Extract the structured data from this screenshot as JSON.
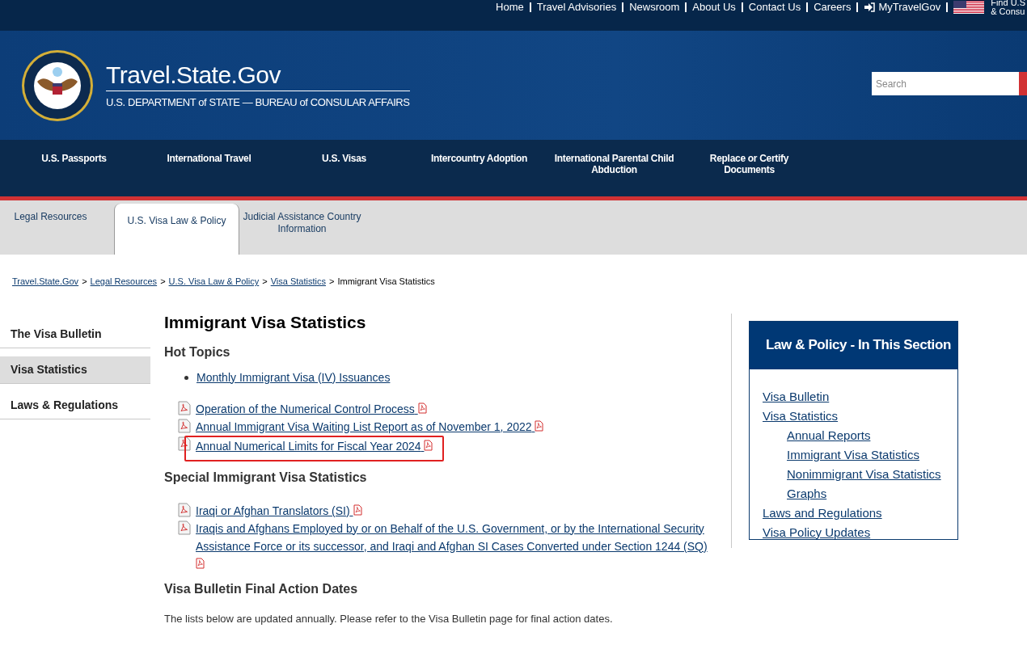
{
  "utility_links": [
    {
      "label": "Home",
      "kind": "text"
    },
    {
      "label": "Travel Advisories",
      "kind": "text"
    },
    {
      "label": "Newsroom",
      "kind": "text"
    },
    {
      "label": "About Us",
      "kind": "text"
    },
    {
      "label": "Contact Us",
      "kind": "text"
    },
    {
      "label": "Careers",
      "kind": "text"
    },
    {
      "label": "MyTravelGov",
      "kind": "login"
    }
  ],
  "embassy_link": [
    "Find U.S",
    "& Consu"
  ],
  "site": {
    "title": "Travel.State.Gov",
    "subtitle": "U.S. DEPARTMENT of STATE — BUREAU of CONSULAR AFFAIRS"
  },
  "search": {
    "placeholder": "Search"
  },
  "main_nav": [
    "U.S. Passports",
    "International Travel",
    "U.S. Visas",
    "Intercountry Adoption",
    "International Parental Child Abduction",
    "Replace or Certify Documents"
  ],
  "sub_tabs": [
    {
      "label": "Legal Resources",
      "selected": false
    },
    {
      "label": "U.S. Visa Law & Policy",
      "selected": true
    },
    {
      "label": "Judicial Assistance Country Information",
      "selected": false
    }
  ],
  "breadcrumb": {
    "links": [
      {
        "label": "Travel.State.Gov",
        "separator": ">"
      },
      {
        "label": "Legal Resources",
        "separator": ">"
      },
      {
        "label": "U.S. Visa Law & Policy",
        "separator": ">"
      },
      {
        "label": "Visa Statistics",
        "separator": ">"
      }
    ],
    "current": "Immigrant Visa Statistics"
  },
  "sidebar": [
    {
      "label": "The Visa Bulletin",
      "selected": false
    },
    {
      "label": "Visa Statistics",
      "selected": true
    },
    {
      "label": "Laws & Regulations",
      "selected": false
    }
  ],
  "page_title": "Immigrant Visa Statistics",
  "sections": [
    {
      "heading": "Hot Topics",
      "items": [
        {
          "kind": "bullet",
          "label": "Monthly Immigrant Visa (IV) Issuances"
        },
        {
          "kind": "pdf",
          "label": "Operation of the Numerical Control Process"
        },
        {
          "kind": "pdf",
          "label": "Annual Immigrant Visa Waiting List Report as of November 1, 2022"
        },
        {
          "kind": "pdf",
          "label": "Annual Numerical Limits for Fiscal Year 2024",
          "highlighted": true
        }
      ]
    },
    {
      "heading": "Special Immigrant Visa Statistics",
      "items": [
        {
          "kind": "pdf",
          "label": "Iraqi or Afghan Translators (SI)"
        },
        {
          "kind": "pdf",
          "label": "Iraqis and Afghans Employed by or on Behalf of the U.S. Government, or by the International Security Assistance Force or its successor, and Iraqi and Afghan SI Cases Converted under Section 1244 (SQ)"
        }
      ]
    },
    {
      "heading": "Visa Bulletin Final Action Dates",
      "text": "The lists below are updated annually. Please refer to the Visa Bulletin page for final action dates."
    }
  ],
  "section_box": {
    "title": "Law & Policy - In This Section",
    "links": [
      {
        "label": "Visa Bulletin"
      },
      {
        "label": "Visa Statistics",
        "children": [
          {
            "label": "Annual Reports"
          },
          {
            "label": "Immigrant Visa Statistics"
          },
          {
            "label": "Nonimmigrant Visa Statistics"
          },
          {
            "label": "Graphs"
          }
        ]
      },
      {
        "label": "Laws and Regulations"
      },
      {
        "label": "Visa Policy Updates"
      }
    ]
  }
}
